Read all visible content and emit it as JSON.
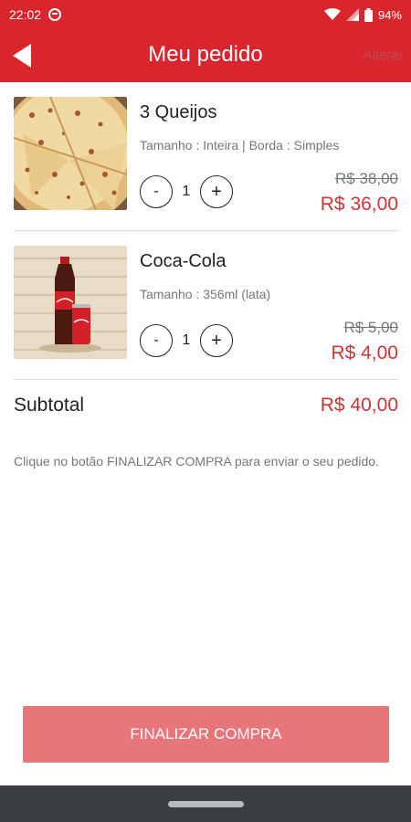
{
  "status": {
    "time": "22:02",
    "battery": "94%",
    "icons": [
      "spotify-icon",
      "wifi-icon",
      "signal-icon",
      "battery-icon"
    ]
  },
  "header": {
    "title": "Meu pedido",
    "action_label": "Alterar",
    "back_icon": "back-arrow-icon",
    "color": "#d9262e"
  },
  "items": [
    {
      "name": "3 Queijos",
      "details": "Tamanho : Inteira | Borda : Simples",
      "quantity": "1",
      "old_price": "R$ 38,00",
      "price": "R$ 36,00",
      "image": "pizza-image"
    },
    {
      "name": "Coca-Cola",
      "details": "Tamanho : 356ml (lata)",
      "quantity": "1",
      "old_price": "R$ 5,00",
      "price": "R$ 4,00",
      "image": "coca-cola-image"
    }
  ],
  "stepper": {
    "minus": "-",
    "plus": "+"
  },
  "summary": {
    "subtotal_label": "Subtotal",
    "subtotal_value": "R$ 40,00",
    "hint": "Clique no botão FINALIZAR COMPRA para enviar o seu pedido."
  },
  "footer": {
    "button_label": "FINALIZAR COMPRA",
    "button_color": "#e7767a"
  }
}
